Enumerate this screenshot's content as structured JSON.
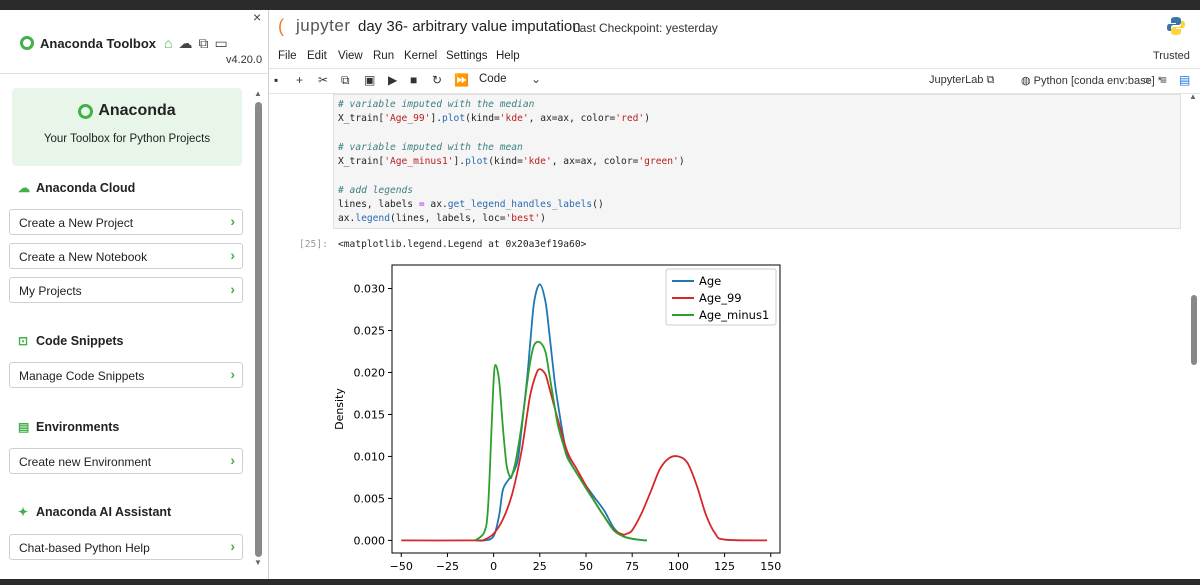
{
  "sidebar": {
    "title": "Anaconda Toolbox",
    "version": "v4.20.0",
    "close_glyph": "×",
    "header_icons": [
      "home-icon",
      "cloud-icon",
      "code-icon",
      "terminal-icon"
    ],
    "brand_name": "Anaconda",
    "brand_tagline": "Your Toolbox for Python Projects",
    "sections": {
      "cloud": {
        "title": "Anaconda Cloud",
        "icon": "cloud-icon",
        "items": [
          "Create a New Project",
          "Create a New Notebook",
          "My Projects"
        ]
      },
      "snippets": {
        "title": "Code Snippets",
        "icon": "code-snippet-icon",
        "items": [
          "Manage Code Snippets"
        ]
      },
      "environments": {
        "title": "Environments",
        "icon": "environment-icon",
        "items": [
          "Create new Environment"
        ]
      },
      "assistant": {
        "title": "Anaconda AI Assistant",
        "icon": "sparkle-icon",
        "items": [
          "Chat-based Python Help"
        ]
      }
    },
    "chevron": "›"
  },
  "notebook": {
    "jupyter_word": "jupyter",
    "title": "day 36- arbitrary value imputation",
    "checkpoint": "Last Checkpoint: yesterday",
    "menu": [
      "File",
      "Edit",
      "View",
      "Run",
      "Kernel",
      "Settings",
      "Help"
    ],
    "trusted": "Trusted",
    "cell_type": "Code",
    "jupyterlab_link": "JupyterLab",
    "kernel": "Python [conda env:base] *",
    "code_lines": {
      "l1": "# variable imputed with the median",
      "l2a": "X_train[",
      "l2s": "'Age_99'",
      "l2b": "].",
      "l2f": "plot",
      "l2c": "(kind=",
      "l2s2": "'kde'",
      "l2d": ", ax=ax, color=",
      "l2s3": "'red'",
      "l2e": ")",
      "l3": "# variable imputed with the mean",
      "l4a": "X_train[",
      "l4s": "'Age_minus1'",
      "l4b": "].",
      "l4f": "plot",
      "l4c": "(kind=",
      "l4s2": "'kde'",
      "l4d": ", ax=ax, color=",
      "l4s3": "'green'",
      "l4e": ")",
      "l5": "# add legends",
      "l6a": "lines, labels ",
      "l6p": "=",
      "l6b": " ax.",
      "l6f": "get_legend_handles_labels",
      "l6c": "()",
      "l7a": "ax.",
      "l7f": "legend",
      "l7b": "(lines, labels, loc=",
      "l7s": "'best'",
      "l7c": ")"
    },
    "output_prompt": "[25]:",
    "output_text": "<matplotlib.legend.Legend at 0x20a3ef19a60>"
  },
  "chart_data": {
    "type": "line",
    "ylabel": "Density",
    "xlim": [
      -55,
      155
    ],
    "ylim": [
      -0.0015,
      0.0328
    ],
    "xticks": [
      -50,
      -25,
      0,
      25,
      50,
      75,
      100,
      125,
      150
    ],
    "xtick_labels": [
      "−50",
      "−25",
      "0",
      "25",
      "50",
      "75",
      "100",
      "125",
      "150"
    ],
    "yticks": [
      0.0,
      0.005,
      0.01,
      0.015,
      0.02,
      0.025,
      0.03
    ],
    "ytick_labels": [
      "0.000",
      "0.005",
      "0.010",
      "0.015",
      "0.020",
      "0.025",
      "0.030"
    ],
    "legend_position": "top-right",
    "series": [
      {
        "name": "Age",
        "color": "#1f77b4",
        "x": [
          -10,
          -5,
          0,
          3,
          5,
          8,
          10,
          13,
          15,
          18,
          20,
          22,
          25,
          28,
          30,
          33,
          35,
          38,
          40,
          45,
          50,
          55,
          60,
          65,
          70,
          75,
          80,
          83
        ],
        "y": [
          0,
          0,
          0.0005,
          0.003,
          0.006,
          0.0072,
          0.0078,
          0.0095,
          0.013,
          0.019,
          0.024,
          0.0285,
          0.0305,
          0.0285,
          0.025,
          0.019,
          0.016,
          0.012,
          0.01,
          0.008,
          0.0065,
          0.005,
          0.0035,
          0.0015,
          0.0005,
          0.0002,
          5e-05,
          0
        ]
      },
      {
        "name": "Age_99",
        "color": "#d62728",
        "x": [
          -50,
          -10,
          -5,
          0,
          5,
          10,
          15,
          18,
          20,
          23,
          25,
          28,
          30,
          35,
          40,
          45,
          50,
          55,
          60,
          65,
          70,
          72,
          75,
          80,
          85,
          90,
          95,
          100,
          105,
          110,
          115,
          120,
          125,
          148
        ],
        "y": [
          0,
          0,
          0.0001,
          0.0008,
          0.0025,
          0.0055,
          0.0105,
          0.0148,
          0.0175,
          0.0198,
          0.0204,
          0.0198,
          0.0183,
          0.0142,
          0.0105,
          0.0085,
          0.0065,
          0.0045,
          0.0028,
          0.0013,
          0.0007,
          0.0008,
          0.0012,
          0.0032,
          0.0058,
          0.0085,
          0.0098,
          0.01,
          0.0092,
          0.0065,
          0.003,
          0.0008,
          0.0001,
          0
        ]
      },
      {
        "name": "Age_minus1",
        "color": "#2ca02c",
        "x": [
          -10,
          -5,
          -3,
          -1,
          0,
          1,
          3,
          5,
          7,
          9,
          10,
          12,
          15,
          18,
          20,
          22,
          25,
          28,
          30,
          33,
          35,
          38,
          40,
          45,
          50,
          55,
          60,
          65,
          70,
          75,
          80,
          83
        ],
        "y": [
          0,
          0.001,
          0.004,
          0.014,
          0.019,
          0.0209,
          0.019,
          0.0135,
          0.009,
          0.0075,
          0.0078,
          0.0095,
          0.0135,
          0.0185,
          0.0215,
          0.0233,
          0.0236,
          0.0225,
          0.02,
          0.016,
          0.0135,
          0.0112,
          0.0098,
          0.008,
          0.0062,
          0.0045,
          0.0028,
          0.0012,
          0.0005,
          0.0002,
          5e-05,
          0
        ]
      }
    ]
  }
}
